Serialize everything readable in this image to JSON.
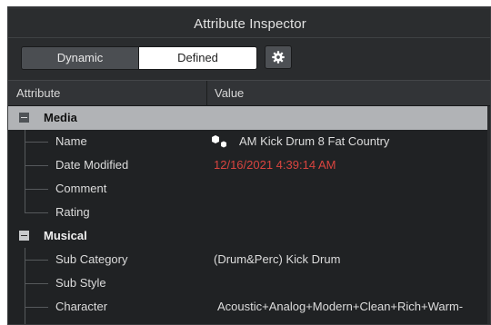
{
  "panel": {
    "title": "Attribute Inspector"
  },
  "toolbar": {
    "dynamic_label": "Dynamic",
    "defined_label": "Defined",
    "selected": "Defined",
    "settings_icon": "gear-icon"
  },
  "columns": {
    "attribute": "Attribute",
    "value": "Value"
  },
  "groups": {
    "media": {
      "label": "Media",
      "expanded": true,
      "selected": true,
      "items": [
        {
          "attribute": "Name",
          "value": "AM Kick Drum 8 Fat Country",
          "icon": "sound-file-icon"
        },
        {
          "attribute": "Date Modified",
          "value": "12/16/2021 4:39:14 AM",
          "color": "#d9443f"
        },
        {
          "attribute": "Comment",
          "value": ""
        },
        {
          "attribute": "Rating",
          "value": ""
        }
      ]
    },
    "musical": {
      "label": "Musical",
      "expanded": true,
      "items": [
        {
          "attribute": "Sub Category",
          "value": "(Drum&Perc) Kick Drum"
        },
        {
          "attribute": "Sub Style",
          "value": ""
        },
        {
          "attribute": "Character",
          "value": "Acoustic+Analog+Modern+Clean+Rich+Warm-"
        }
      ]
    }
  },
  "colors": {
    "panel_bg": "#202224",
    "selected_row": "#b1b3b6",
    "date_text": "#d9443f"
  }
}
